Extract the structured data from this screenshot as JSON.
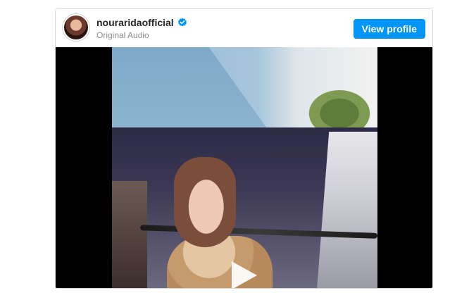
{
  "header": {
    "username": "nouraridaofficial",
    "subtitle": "Original Audio",
    "verified": true,
    "view_profile_label": "View profile"
  },
  "colors": {
    "button_bg": "#0095f6",
    "verified_blue": "#0095f6",
    "media_bg": "#000000"
  },
  "icons": {
    "verified": "verified-badge-icon",
    "play": "play-icon"
  }
}
